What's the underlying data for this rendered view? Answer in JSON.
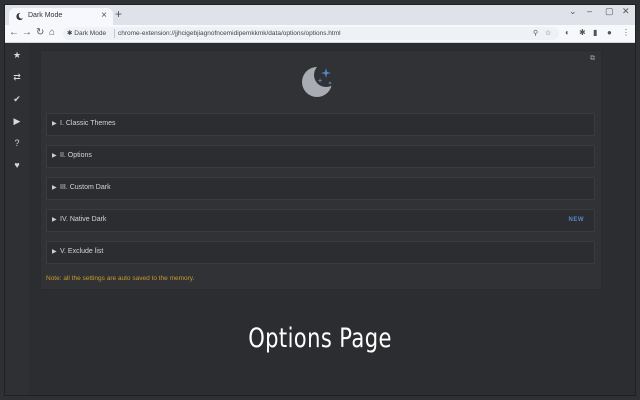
{
  "browser": {
    "tab_title": "Dark Mode",
    "close_glyph": "×",
    "newtab_glyph": "+",
    "window_controls": {
      "dropdown": "⌄",
      "minimize": "–",
      "maximize": "▢",
      "close": "✕"
    },
    "nav": {
      "back": "←",
      "forward": "→",
      "reload": "↻",
      "home": "⌂"
    },
    "omnibox": {
      "chip": "Dark Mode",
      "url": "chrome-extension://jjhcigebjiagnofncemidipemkkmk/data/options/options.html"
    }
  },
  "sidebar": {
    "items": [
      {
        "name": "star-icon",
        "glyph": "★"
      },
      {
        "name": "swap-icon",
        "glyph": "⇄"
      },
      {
        "name": "check-icon",
        "glyph": "✔"
      },
      {
        "name": "youtube-icon",
        "glyph": "▶"
      },
      {
        "name": "help-icon",
        "glyph": "?"
      },
      {
        "name": "heart-icon",
        "glyph": "♥"
      }
    ]
  },
  "sections": [
    {
      "arrow": "▶",
      "label": "I. Classic Themes",
      "badge": ""
    },
    {
      "arrow": "▶",
      "label": "II. Options",
      "badge": ""
    },
    {
      "arrow": "▶",
      "label": "III. Custom Dark",
      "badge": ""
    },
    {
      "arrow": "▶",
      "label": "IV. Native Dark",
      "badge": "NEW"
    },
    {
      "arrow": "▶",
      "label": "V. Exclude list",
      "badge": ""
    }
  ],
  "note": "Note: all the settings are auto saved to the memory.",
  "caption": "Options Page",
  "colors": {
    "accent": "#5b86c5",
    "note": "#c79a2c",
    "background": "#2c2d30"
  }
}
